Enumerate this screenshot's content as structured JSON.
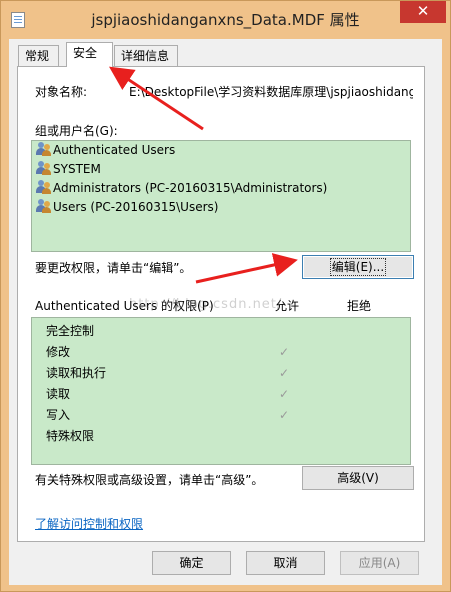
{
  "window": {
    "title": "jspjiaoshidanganxns_Data.MDF 属性",
    "close_label": "✕"
  },
  "tabs": [
    {
      "label": "常规"
    },
    {
      "label": "安全"
    },
    {
      "label": "详细信息"
    }
  ],
  "security": {
    "object_name_label": "对象名称:",
    "object_name_value": "E:\\DesktopFile\\学习资料数据库原理\\jspjiaoshidanganxns",
    "group_label": "组或用户名(G):",
    "users": [
      {
        "name": "Authenticated Users"
      },
      {
        "name": "SYSTEM"
      },
      {
        "name": "Administrators (PC-20160315\\Administrators)"
      },
      {
        "name": "Users (PC-20160315\\Users)"
      }
    ],
    "change_hint": "要更改权限，请单击“编辑”。",
    "edit_label": "编辑(E)...",
    "perm_title": "Authenticated Users 的权限(P)",
    "allow_header": "允许",
    "deny_header": "拒绝",
    "permissions": [
      {
        "name": "完全控制",
        "allow": ""
      },
      {
        "name": "修改",
        "allow": "✓"
      },
      {
        "name": "读取和执行",
        "allow": "✓"
      },
      {
        "name": "读取",
        "allow": "✓"
      },
      {
        "name": "写入",
        "allow": "✓"
      },
      {
        "name": "特殊权限",
        "allow": ""
      }
    ],
    "advanced_hint": "有关特殊权限或高级设置，请单击“高级”。",
    "advanced_label": "高级(V)",
    "learn_link": "了解访问控制和权限"
  },
  "footer": {
    "ok_label": "确定",
    "cancel_label": "取消",
    "apply_label": "应用(A)"
  },
  "watermark": "http://blog.csdn.net/",
  "colors": {
    "titlebar": "#f0c28a",
    "close": "#c7372f",
    "list_bg": "#c9e9c9",
    "arrow": "#e8201e",
    "link": "#0b66c3"
  }
}
